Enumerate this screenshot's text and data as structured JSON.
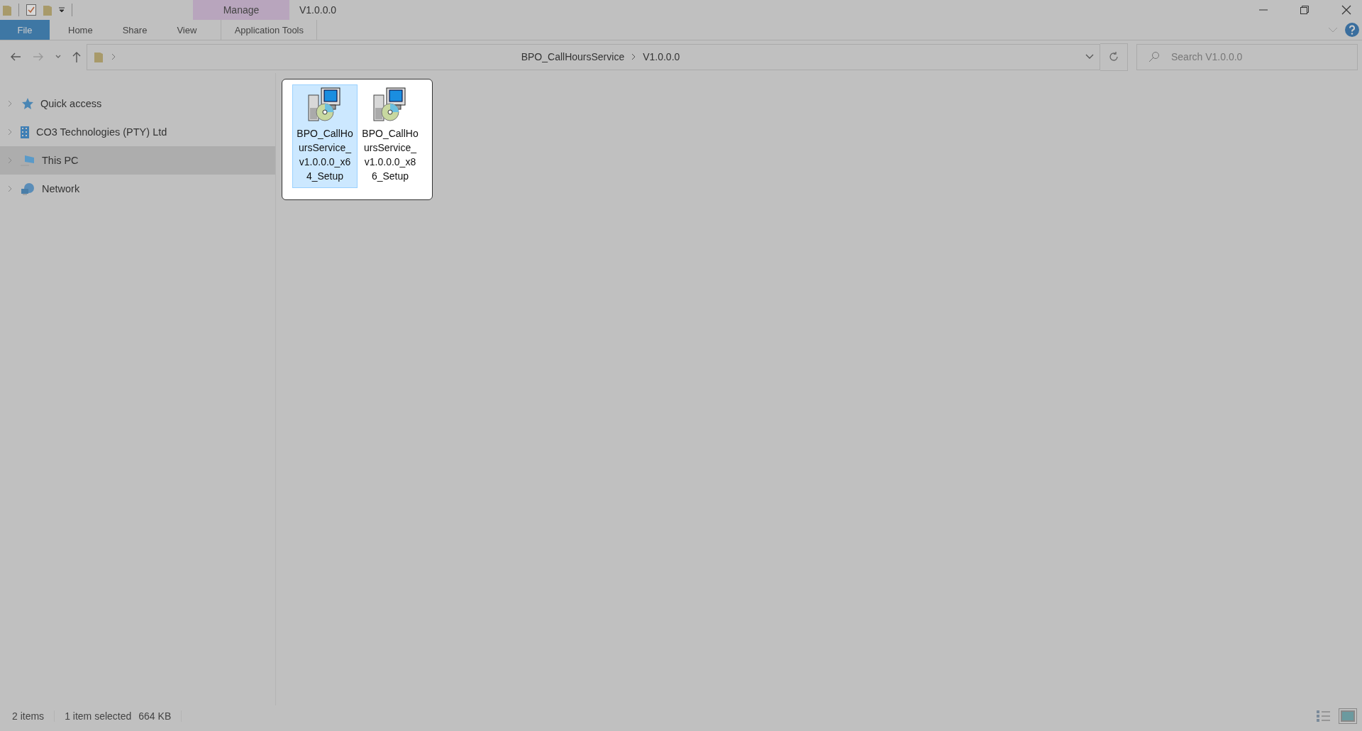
{
  "window": {
    "title": "V1.0.0.0"
  },
  "contextual_tab_group": {
    "label": "Manage"
  },
  "ribbon_tabs": [
    {
      "label": "File",
      "kind": "file",
      "selected": false
    },
    {
      "label": "Home",
      "kind": "tab",
      "selected": false
    },
    {
      "label": "Share",
      "kind": "tab",
      "selected": false
    },
    {
      "label": "View",
      "kind": "tab",
      "selected": false
    },
    {
      "label": "Application Tools",
      "kind": "contextual",
      "selected": false
    }
  ],
  "address_bar": {
    "breadcrumbs": [
      "BPO_CallHoursService",
      "V1.0.0.0"
    ]
  },
  "search": {
    "placeholder": "Search V1.0.0.0"
  },
  "sidebar": {
    "items": [
      {
        "label": "Quick access",
        "kind": "star",
        "expanded": false,
        "selected": false
      },
      {
        "label": "CO3 Technologies (PTY) Ltd",
        "kind": "building",
        "expanded": false,
        "selected": false
      },
      {
        "label": "This PC",
        "kind": "pc",
        "expanded": false,
        "selected": true
      },
      {
        "label": "Network",
        "kind": "network",
        "expanded": false,
        "selected": false
      }
    ]
  },
  "files": [
    {
      "name": "BPO_CallHoursService_v1.0.0.0_x64_Setup",
      "selected": true
    },
    {
      "name": "BPO_CallHoursService_v1.0.0.0_x86_Setup",
      "selected": false
    }
  ],
  "status_bar": {
    "item_count": "2 items",
    "selection": "1 item selected",
    "size": "664 KB"
  },
  "view_buttons": [
    {
      "kind": "details",
      "selected": false
    },
    {
      "kind": "large-icons",
      "selected": true
    }
  ]
}
